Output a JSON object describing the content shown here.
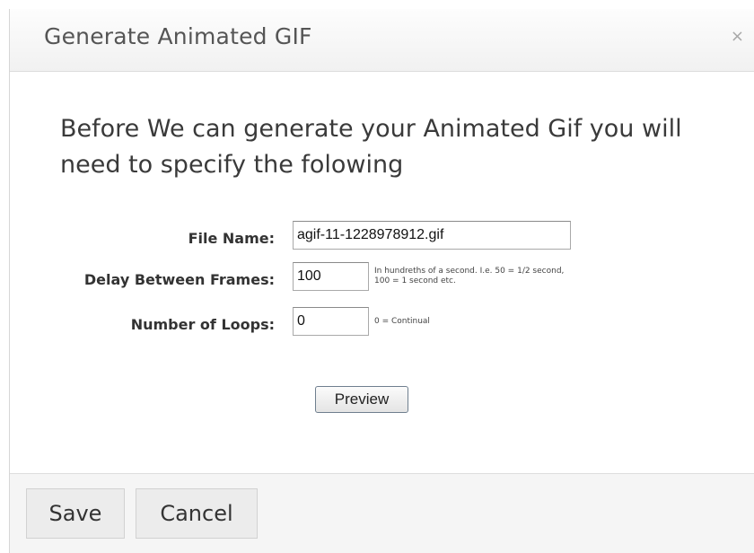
{
  "dialog": {
    "title": "Generate Animated GIF",
    "close_symbol": "×"
  },
  "intro": {
    "text": "Before We can generate your Animated Gif you will need to specify the folowing"
  },
  "form": {
    "file_name": {
      "label": "File Name:",
      "value": "agif-11-1228978912.gif"
    },
    "delay": {
      "label": "Delay Between Frames:",
      "value": "100",
      "hint_line1": "In hundreths of a second. I.e. 50 = 1/2 second,",
      "hint_line2": "100 = 1 second etc."
    },
    "loops": {
      "label": "Number of Loops:",
      "value": "0",
      "hint": "0 = Continual"
    },
    "preview_label": "Preview"
  },
  "footer": {
    "save_label": "Save",
    "cancel_label": "Cancel"
  }
}
